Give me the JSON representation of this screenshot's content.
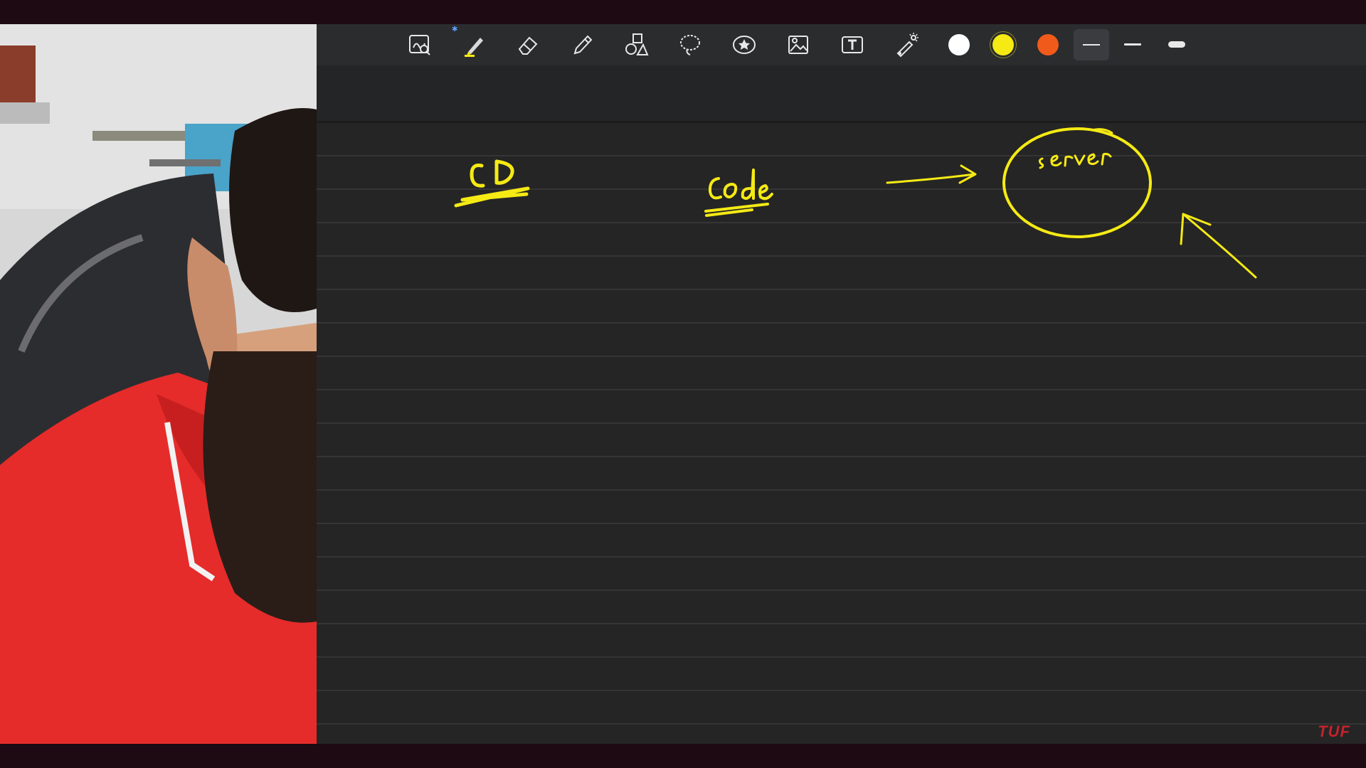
{
  "toolbar": {
    "tools": [
      {
        "name": "zoom-window-icon"
      },
      {
        "name": "highlighter-pen-icon"
      },
      {
        "name": "eraser-icon"
      },
      {
        "name": "pencil-icon"
      },
      {
        "name": "shapes-icon"
      },
      {
        "name": "lasso-icon"
      },
      {
        "name": "sticker-icon"
      },
      {
        "name": "image-icon"
      },
      {
        "name": "text-box-icon"
      },
      {
        "name": "laser-pointer-icon"
      }
    ],
    "colors": [
      "#ffffff",
      "#f5ea14",
      "#f05a1a"
    ],
    "stroke_widths": [
      "thin",
      "medium",
      "thick"
    ],
    "selected_stroke_width": "thin",
    "selected_tool": "highlighter-pen-icon"
  },
  "canvas": {
    "ink_color": "#f5ea14",
    "handwriting": [
      "CD",
      "Code",
      "server"
    ]
  },
  "watermark": {
    "text": "TUF",
    "color": "#c2232b"
  }
}
